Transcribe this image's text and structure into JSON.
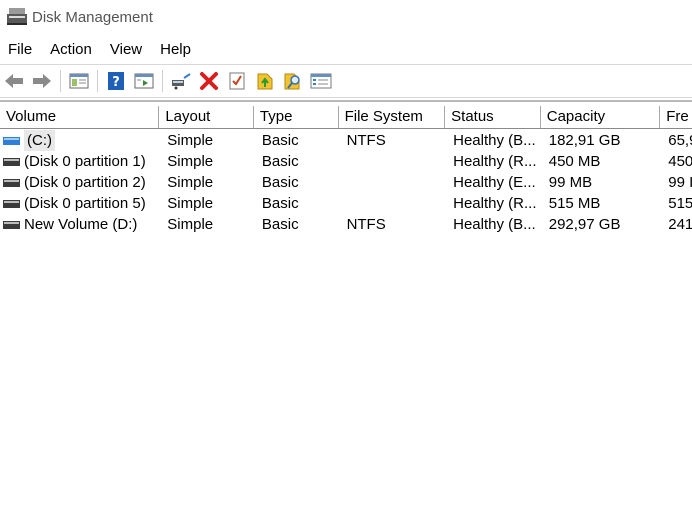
{
  "window": {
    "title": "Disk Management"
  },
  "menu": [
    "File",
    "Action",
    "View",
    "Help"
  ],
  "toolbar": {
    "icons": [
      "back-arrow-icon",
      "forward-arrow-icon",
      "console-tree-icon",
      "help-icon",
      "action-pane-icon",
      "connect-drive-icon",
      "delete-icon",
      "check-icon",
      "export-icon",
      "find-icon",
      "properties-icon"
    ]
  },
  "columns": [
    "Volume",
    "Layout",
    "Type",
    "File System",
    "Status",
    "Capacity",
    "Fre"
  ],
  "rows": [
    {
      "volume": "(C:)",
      "layout": "Simple",
      "type": "Basic",
      "fs": "NTFS",
      "status": "Healthy (B...",
      "capacity": "182,91 GB",
      "free": "65,9",
      "icon": "blue"
    },
    {
      "volume": "(Disk 0 partition 1)",
      "layout": "Simple",
      "type": "Basic",
      "fs": "",
      "status": "Healthy (R...",
      "capacity": "450 MB",
      "free": "450",
      "icon": "dark"
    },
    {
      "volume": "(Disk 0 partition 2)",
      "layout": "Simple",
      "type": "Basic",
      "fs": "",
      "status": "Healthy (E...",
      "capacity": "99 MB",
      "free": "99 I",
      "icon": "dark"
    },
    {
      "volume": "(Disk 0 partition 5)",
      "layout": "Simple",
      "type": "Basic",
      "fs": "",
      "status": "Healthy (R...",
      "capacity": "515 MB",
      "free": "515",
      "icon": "dark"
    },
    {
      "volume": "New Volume (D:)",
      "layout": "Simple",
      "type": "Basic",
      "fs": "NTFS",
      "status": "Healthy (B...",
      "capacity": "292,97 GB",
      "free": "241",
      "icon": "dark"
    }
  ],
  "colors": {
    "system_drive": "#2f7fd6",
    "data_drive": "#3a3a3a",
    "delete": "#d81e1e",
    "folder": "#f2c230"
  }
}
